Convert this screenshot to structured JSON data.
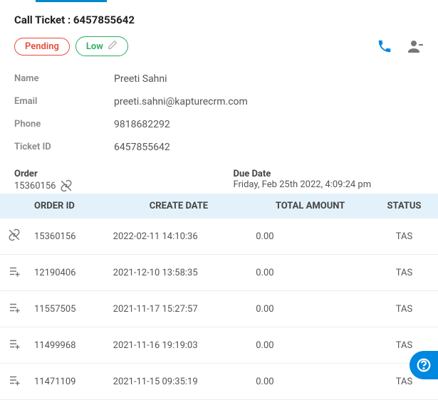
{
  "ticket": {
    "titlePrefix": "Call Ticket : ",
    "ticketNumber": "6457855642",
    "status": "Pending",
    "priority": "Low"
  },
  "info": {
    "nameLabel": "Name",
    "nameValue": "Preeti Sahni",
    "emailLabel": "Email",
    "emailValue": "preeti.sahni@kapturecrm.com",
    "phoneLabel": "Phone",
    "phoneValue": "9818682292",
    "ticketIdLabel": "Ticket ID",
    "ticketIdValue": "6457855642"
  },
  "subinfo": {
    "orderLabel": "Order",
    "orderValue": "15360156",
    "dueLabel": "Due Date",
    "dueValue": "Friday, Feb 25th 2022, 4:09:24 pm"
  },
  "orders": {
    "headers": {
      "orderId": "ORDER ID",
      "createDate": "CREATE DATE",
      "totalAmount": "TOTAL AMOUNT",
      "status": "STATUS"
    },
    "rows": [
      {
        "orderId": "15360156",
        "createDate": "2022-02-11 14:10:36",
        "totalAmount": "0.00",
        "status": "TAS",
        "linked": true
      },
      {
        "orderId": "12190406",
        "createDate": "2021-12-10 13:58:35",
        "totalAmount": "0.00",
        "status": "TAS",
        "linked": false
      },
      {
        "orderId": "11557505",
        "createDate": "2021-11-17 15:27:57",
        "totalAmount": "0.00",
        "status": "TAS",
        "linked": false
      },
      {
        "orderId": "11499968",
        "createDate": "2021-11-16 19:19:03",
        "totalAmount": "0.00",
        "status": "TAS",
        "linked": false
      },
      {
        "orderId": "11471109",
        "createDate": "2021-11-15 09:35:19",
        "totalAmount": "0.00",
        "status": "TAS",
        "linked": false
      }
    ]
  }
}
